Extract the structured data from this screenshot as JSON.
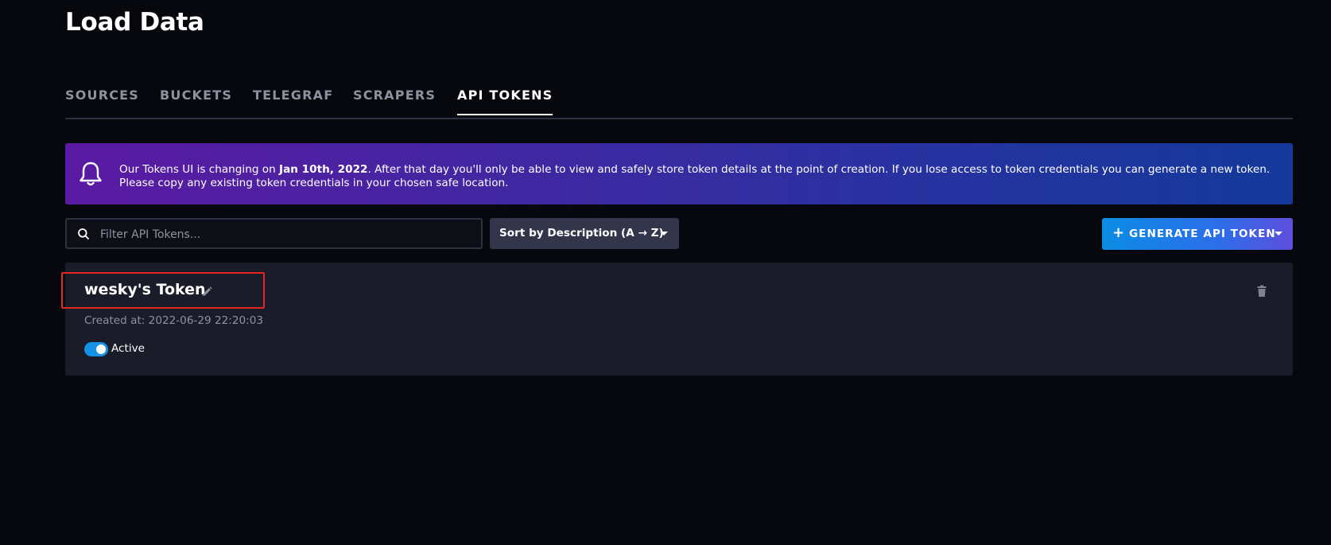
{
  "page": {
    "title": "Load Data"
  },
  "tabs": [
    {
      "label": "SOURCES"
    },
    {
      "label": "BUCKETS"
    },
    {
      "label": "TELEGRAF"
    },
    {
      "label": "SCRAPERS"
    },
    {
      "label": "API TOKENS"
    }
  ],
  "active_tab": "API TOKENS",
  "banner": {
    "text_1": "Our Tokens UI is changing on ",
    "date": "Jan 10th, 2022",
    "text_2": ". After that day you'll only be able to view and safely store token details at the point of creation. If you lose access to token credentials you can generate a new token. Please copy any existing token credentials in your chosen safe location.",
    "icon": "bell-icon"
  },
  "filter": {
    "placeholder": "Filter API Tokens...",
    "value": ""
  },
  "sort": {
    "label": "Sort by Description (A → Z)"
  },
  "generate_button": {
    "plus": "+",
    "label": "GENERATE API TOKEN"
  },
  "token": {
    "name": "wesky's Token",
    "created": "Created at: 2022-06-29 22:20:03",
    "status": "Active",
    "active": true
  },
  "colors": {
    "background": "#07080d",
    "card": "#1b1c29",
    "highlight_border": "#e3261e",
    "toggle_on": "#1592e6"
  }
}
